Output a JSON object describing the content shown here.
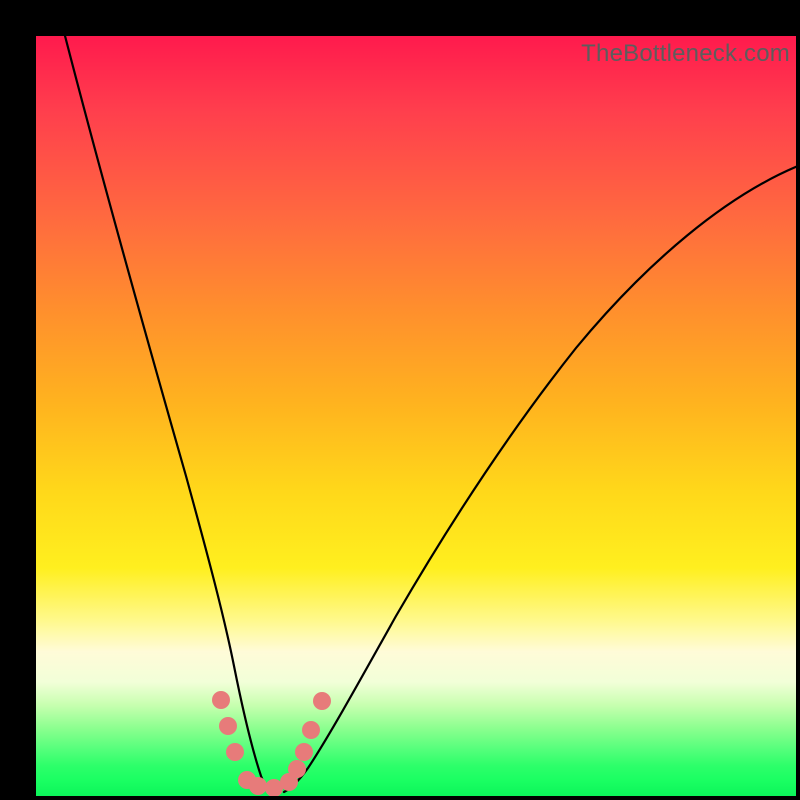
{
  "watermark": "TheBottleneck.com",
  "colors": {
    "frame": "#000000",
    "curve": "#000000",
    "marker": "#e77b7a",
    "gradient_top": "#ff1a4d",
    "gradient_bottom": "#0cf55a"
  },
  "chart_data": {
    "type": "line",
    "title": "",
    "xlabel": "",
    "ylabel": "",
    "xlim": [
      0,
      100
    ],
    "ylim": [
      0,
      100
    ],
    "grid": false,
    "legend": false,
    "annotations": [
      "TheBottleneck.com"
    ],
    "series": [
      {
        "name": "left-curve",
        "x": [
          4,
          8,
          12,
          16,
          19,
          22,
          24,
          25,
          26,
          27,
          28,
          29,
          30
        ],
        "y": [
          100,
          80,
          60,
          42,
          29,
          18,
          11,
          8,
          6,
          4,
          2.5,
          1.5,
          1
        ]
      },
      {
        "name": "right-curve",
        "x": [
          32,
          34,
          36,
          40,
          46,
          54,
          62,
          70,
          80,
          90,
          100
        ],
        "y": [
          1,
          2,
          4,
          9,
          18,
          30,
          42,
          52,
          63,
          73,
          82
        ]
      }
    ],
    "markers": [
      {
        "x": 24.0,
        "y": 12.0
      },
      {
        "x": 25.0,
        "y": 8.5
      },
      {
        "x": 26.0,
        "y": 5.0
      },
      {
        "x": 27.5,
        "y": 1.3
      },
      {
        "x": 29.0,
        "y": 0.9
      },
      {
        "x": 31.0,
        "y": 0.8
      },
      {
        "x": 33.0,
        "y": 1.8
      },
      {
        "x": 34.0,
        "y": 3.5
      },
      {
        "x": 35.0,
        "y": 6.0
      },
      {
        "x": 36.0,
        "y": 9.0
      },
      {
        "x": 37.5,
        "y": 12.5
      }
    ]
  }
}
